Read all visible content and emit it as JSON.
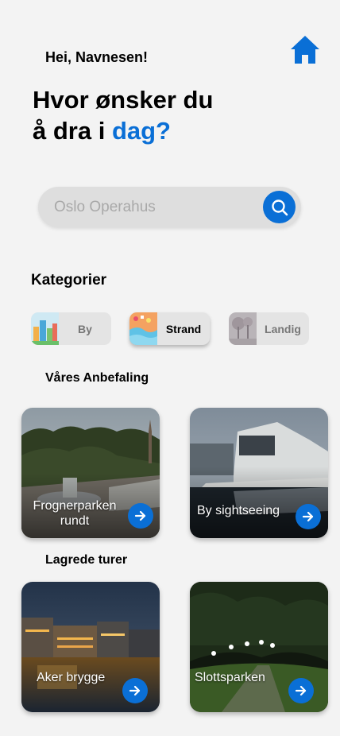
{
  "header": {
    "greeting": "Hei, Navnesen!",
    "headline_line1": "Hvor ønsker du",
    "headline_line2_prefix": "å dra i ",
    "headline_line2_accent": "dag?",
    "home_icon": "home-icon"
  },
  "search": {
    "placeholder": "Oslo Operahus",
    "button_icon": "search-icon"
  },
  "categories": {
    "title": "Kategorier",
    "items": [
      {
        "label": "By",
        "selected": false
      },
      {
        "label": "Strand",
        "selected": true
      },
      {
        "label": "Landig",
        "selected": false
      }
    ]
  },
  "recommendations": {
    "title": "Våres Anbefaling",
    "cards": [
      {
        "title": "Frognerparken rundt"
      },
      {
        "title": "By sightseeing"
      }
    ]
  },
  "saved": {
    "title": "Lagrede turer",
    "cards": [
      {
        "title": "Aker brygge"
      },
      {
        "title": "Slottsparken"
      }
    ]
  },
  "colors": {
    "accent": "#0a6fd6",
    "background": "#f3f3f3"
  }
}
